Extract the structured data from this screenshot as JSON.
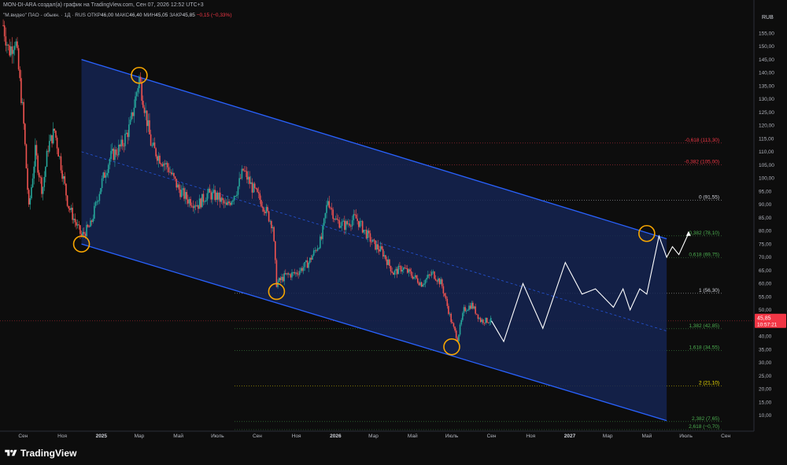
{
  "header": {
    "author_line": "MON-DI-ARA создал(а) график на TradingView.com, Сен 07, 2026 12:52 UTC+3"
  },
  "symbol": {
    "name": "\"М.видео\" ПАО - обыкн. · 1Д · RUS",
    "open_label": "ОТКР",
    "open": "46,00",
    "high_label": "МАКС",
    "high": "46,40",
    "low_label": "МИН",
    "low": "45,05",
    "close_label": "ЗАКР",
    "close": "45,85",
    "change": "−0,15 (−0,33%)"
  },
  "currency": "RUB",
  "brand": {
    "name": "TradingView",
    "logo_icon": "tradingview-logo-icon"
  },
  "colors": {
    "background": "#0d0d0d",
    "channel_fill": "#152552",
    "channel_line": "#2962ff",
    "candle_up": "#26a69a",
    "candle_down": "#ef5350",
    "marker": "#f7a600",
    "projection": "#ffffff",
    "price_label": "#f23645"
  },
  "chart_data": {
    "type": "candlestick",
    "y_axis": {
      "ticks": [
        "10,00",
        "15,00",
        "20,00",
        "25,00",
        "30,00",
        "35,00",
        "40,00",
        "50,00",
        "55,00",
        "60,00",
        "65,00",
        "70,00",
        "75,00",
        "80,00",
        "85,00",
        "90,00",
        "95,00",
        "100,00",
        "105,00",
        "110,00",
        "115,00",
        "120,00",
        "125,00",
        "130,00",
        "135,00",
        "140,00",
        "145,00",
        "150,00",
        "155,00"
      ],
      "range": [
        4,
        164
      ]
    },
    "x_axis": {
      "ticks": [
        "Сен",
        "Ноя",
        "2025",
        "Мар",
        "Май",
        "Июль",
        "Сен",
        "Ноя",
        "2026",
        "Мар",
        "Май",
        "Июль",
        "Сен",
        "Ноя",
        "2027",
        "Мар",
        "Май",
        "Июль",
        "Сен"
      ],
      "tick_dates": [
        "2024-09-01",
        "2024-11-01",
        "2025-01-01",
        "2025-03-01",
        "2025-05-01",
        "2025-07-01",
        "2025-09-01",
        "2025-11-01",
        "2026-01-01",
        "2026-03-01",
        "2026-05-01",
        "2026-07-01",
        "2026-09-01",
        "2026-11-01",
        "2027-01-01",
        "2027-03-01",
        "2027-05-01",
        "2027-07-01",
        "2027-09-01"
      ]
    },
    "current_price": {
      "value": 45.85,
      "label": "45,85",
      "countdown": "10:57:21"
    },
    "fib_levels": [
      {
        "label": "-0,618 (113,30)",
        "value": 113.3,
        "color": "#f23645"
      },
      {
        "label": "-0,382 (105,00)",
        "value": 105.0,
        "color": "#f23645"
      },
      {
        "label": "0 (91,55)",
        "value": 91.55,
        "color": "#d1d4dc"
      },
      {
        "label": "0,382 (78,10)",
        "value": 78.1,
        "color": "#4caf50"
      },
      {
        "label": "0,618 (69,75)",
        "value": 69.75,
        "color": "#4caf50"
      },
      {
        "label": "1 (56,30)",
        "value": 56.3,
        "color": "#d1d4dc"
      },
      {
        "label": "1,382 (42,85)",
        "value": 42.85,
        "color": "#4caf50"
      },
      {
        "label": "1,618 (34,55)",
        "value": 34.55,
        "color": "#4caf50"
      },
      {
        "label": "2 (21,10)",
        "value": 21.1,
        "color": "#f7e600"
      },
      {
        "label": "2,382 (7,65)",
        "value": 7.65,
        "color": "#4caf50"
      },
      {
        "label": "2,618 (−0,70)",
        "value": -0.7,
        "color": "#4caf50"
      }
    ],
    "channel": {
      "upper": [
        [
          "2024-12-01",
          145
        ],
        [
          "2027-06-01",
          77
        ]
      ],
      "lower": [
        [
          "2024-12-01",
          75
        ],
        [
          "2027-06-01",
          8
        ]
      ],
      "mid": [
        [
          "2024-12-01",
          110
        ],
        [
          "2027-06-01",
          42
        ]
      ]
    },
    "touch_points": [
      [
        "2024-12-01",
        75
      ],
      [
        "2025-03-01",
        139
      ],
      [
        "2025-10-01",
        57
      ],
      [
        "2026-07-01",
        36
      ],
      [
        "2027-05-01",
        79
      ]
    ],
    "history": [
      [
        "2024-08-01",
        158
      ],
      [
        "2024-08-10",
        148
      ],
      [
        "2024-08-20",
        153
      ],
      [
        "2024-09-01",
        124
      ],
      [
        "2024-09-10",
        88
      ],
      [
        "2024-09-20",
        110
      ],
      [
        "2024-10-01",
        95
      ],
      [
        "2024-10-10",
        112
      ],
      [
        "2024-10-20",
        118
      ],
      [
        "2024-10-30",
        105
      ],
      [
        "2024-11-10",
        90
      ],
      [
        "2024-11-20",
        84
      ],
      [
        "2024-12-01",
        78
      ],
      [
        "2024-12-15",
        82
      ],
      [
        "2025-01-01",
        98
      ],
      [
        "2025-01-15",
        108
      ],
      [
        "2025-02-01",
        112
      ],
      [
        "2025-02-15",
        120
      ],
      [
        "2025-03-01",
        138
      ],
      [
        "2025-03-10",
        126
      ],
      [
        "2025-03-20",
        112
      ],
      [
        "2025-04-01",
        108
      ],
      [
        "2025-04-15",
        104
      ],
      [
        "2025-05-01",
        96
      ],
      [
        "2025-05-15",
        92
      ],
      [
        "2025-06-01",
        90
      ],
      [
        "2025-06-15",
        94
      ],
      [
        "2025-07-01",
        93
      ],
      [
        "2025-07-15",
        89
      ],
      [
        "2025-08-01",
        96
      ],
      [
        "2025-08-10",
        103
      ],
      [
        "2025-08-25",
        96
      ],
      [
        "2025-09-10",
        90
      ],
      [
        "2025-09-25",
        82
      ],
      [
        "2025-10-01",
        60
      ],
      [
        "2025-10-15",
        63
      ],
      [
        "2025-11-01",
        64
      ],
      [
        "2025-11-20",
        68
      ],
      [
        "2025-12-10",
        77
      ],
      [
        "2025-12-20",
        92
      ],
      [
        "2026-01-01",
        84
      ],
      [
        "2026-01-15",
        82
      ],
      [
        "2026-02-01",
        85
      ],
      [
        "2026-02-15",
        80
      ],
      [
        "2026-03-01",
        75
      ],
      [
        "2026-03-15",
        72
      ],
      [
        "2026-04-01",
        64
      ],
      [
        "2026-04-15",
        66
      ],
      [
        "2026-05-01",
        63
      ],
      [
        "2026-05-15",
        60
      ],
      [
        "2026-06-01",
        64
      ],
      [
        "2026-06-15",
        60
      ],
      [
        "2026-07-01",
        45
      ],
      [
        "2026-07-10",
        39
      ],
      [
        "2026-07-20",
        50
      ],
      [
        "2026-08-01",
        52
      ],
      [
        "2026-08-15",
        46
      ],
      [
        "2026-09-01",
        45.85
      ]
    ],
    "projection": [
      [
        "2026-09-01",
        45.85
      ],
      [
        "2026-09-20",
        38
      ],
      [
        "2026-10-20",
        60
      ],
      [
        "2026-11-20",
        43
      ],
      [
        "2026-12-25",
        68
      ],
      [
        "2027-01-20",
        56
      ],
      [
        "2027-02-10",
        58
      ],
      [
        "2027-03-10",
        51
      ],
      [
        "2027-03-25",
        58
      ],
      [
        "2027-04-05",
        50
      ],
      [
        "2027-04-20",
        58
      ],
      [
        "2027-05-01",
        56
      ],
      [
        "2027-05-20",
        78
      ],
      [
        "2027-06-01",
        70
      ],
      [
        "2027-06-10",
        74
      ],
      [
        "2027-06-20",
        71
      ],
      [
        "2027-07-05",
        79
      ]
    ]
  }
}
